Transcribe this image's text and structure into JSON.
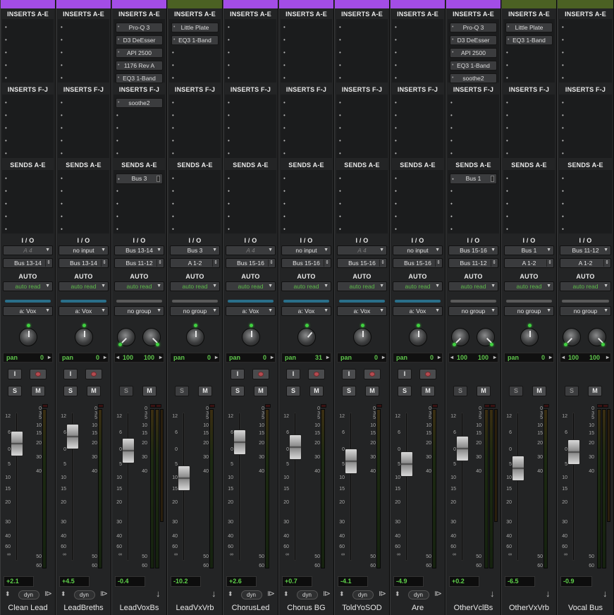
{
  "colors": {
    "purple": "#a34de6",
    "olive": "#4b6123",
    "autoread": "#5dbb4a",
    "green": "#5fd24a"
  },
  "labels": {
    "inserts_ae": "INSERTS A-E",
    "inserts_fj": "INSERTS F-J",
    "sends_ae": "SENDS A-E",
    "io": "I / O",
    "auto": "AUTO",
    "dyn": "dyn",
    "pan": "pan",
    "input_btn": "I",
    "solo": "S",
    "mute": "M"
  },
  "fader_scale": [
    "12",
    "6",
    "0",
    "5",
    "10",
    "15",
    "20",
    "30",
    "40",
    "60",
    "∞"
  ],
  "meter_scale": [
    "0",
    "3",
    "5",
    "10",
    "15",
    "20",
    "30",
    "40",
    "50",
    "60"
  ],
  "channels": [
    {
      "name": "Clean Lead",
      "color": "purple",
      "inserts_ae": [],
      "inserts_fj": [],
      "sends": [],
      "input": "A 4",
      "input_dim": true,
      "output": "Bus 13-14",
      "auto": "auto read",
      "group": "a: Vox",
      "group_color": "#2a6f8a",
      "stereo": false,
      "pan": [
        "0"
      ],
      "knobs": [
        0
      ],
      "has_input_btn": true,
      "has_rec": true,
      "fader_db": 2.1,
      "volume": "+2.1",
      "arrow": "dyn"
    },
    {
      "name": "LeadBreths",
      "color": "purple",
      "inserts_ae": [],
      "inserts_fj": [],
      "sends": [],
      "input": "no input",
      "input_dim": false,
      "output": "Bus 13-14",
      "auto": "auto read",
      "group": "a: Vox",
      "group_color": "#2a6f8a",
      "stereo": false,
      "pan": [
        "0"
      ],
      "knobs": [
        0
      ],
      "has_input_btn": true,
      "has_rec": true,
      "fader_db": 4.5,
      "volume": "+4.5",
      "arrow": "dyn"
    },
    {
      "name": "LeadVoxBs",
      "color": "purple",
      "inserts_ae": [
        "Pro-Q 3",
        "D3 DeEsser",
        "API 2500",
        "1176 Rev A",
        "EQ3 1-Band"
      ],
      "inserts_fj": [
        "soothe2"
      ],
      "sends": [
        "Bus 3"
      ],
      "input": "Bus 13-14",
      "input_dim": false,
      "output": "Bus 11-12",
      "auto": "auto read",
      "group": "no group",
      "group_color": "#5a5a5a",
      "stereo": true,
      "pan": [
        "100",
        "100"
      ],
      "knobs": [
        -135,
        135
      ],
      "has_input_btn": false,
      "has_rec": false,
      "fader_db": -0.4,
      "volume": "-0.4",
      "arrow": "down"
    },
    {
      "name": "LeadVxVrb",
      "color": "olive",
      "inserts_ae": [
        "Little Plate",
        "EQ3 1-Band"
      ],
      "inserts_fj": [],
      "sends": [],
      "input": "Bus 3",
      "input_dim": false,
      "output": "A 1-2",
      "auto": "auto read",
      "group": "no group",
      "group_color": "#5a5a5a",
      "stereo": false,
      "pan": [
        "0"
      ],
      "knobs": [
        0
      ],
      "has_input_btn": false,
      "has_rec": false,
      "fader_db": -10.2,
      "volume": "-10.2",
      "arrow": "down"
    },
    {
      "name": "ChorusLed",
      "color": "purple",
      "inserts_ae": [],
      "inserts_fj": [],
      "sends": [],
      "input": "A 4",
      "input_dim": true,
      "output": "Bus 15-16",
      "auto": "auto read",
      "group": "a: Vox",
      "group_color": "#2a6f8a",
      "stereo": false,
      "pan": [
        "0"
      ],
      "knobs": [
        0
      ],
      "has_input_btn": true,
      "has_rec": true,
      "fader_db": 2.6,
      "volume": "+2.6",
      "arrow": "dyn"
    },
    {
      "name": "Chorus BG",
      "color": "purple",
      "inserts_ae": [],
      "inserts_fj": [],
      "sends": [],
      "input": "no input",
      "input_dim": false,
      "output": "Bus 15-16",
      "auto": "auto read",
      "group": "a: Vox",
      "group_color": "#2a6f8a",
      "stereo": false,
      "pan": [
        "31"
      ],
      "knobs": [
        40
      ],
      "has_input_btn": true,
      "has_rec": true,
      "fader_db": 0.7,
      "volume": "+0.7",
      "arrow": "dyn"
    },
    {
      "name": "ToldYoSOD",
      "color": "purple",
      "inserts_ae": [],
      "inserts_fj": [],
      "sends": [],
      "input": "A 4",
      "input_dim": true,
      "output": "Bus 15-16",
      "auto": "auto read",
      "group": "a: Vox",
      "group_color": "#2a6f8a",
      "stereo": false,
      "pan": [
        "0"
      ],
      "knobs": [
        0
      ],
      "has_input_btn": true,
      "has_rec": true,
      "fader_db": -4.1,
      "volume": "-4.1",
      "arrow": "dyn"
    },
    {
      "name": "Are",
      "color": "purple",
      "inserts_ae": [],
      "inserts_fj": [],
      "sends": [],
      "input": "no input",
      "input_dim": false,
      "output": "Bus 15-16",
      "auto": "auto read",
      "group": "a: Vox",
      "group_color": "#2a6f8a",
      "stereo": false,
      "pan": [
        "0"
      ],
      "knobs": [
        0
      ],
      "has_input_btn": true,
      "has_rec": true,
      "fader_db": -4.9,
      "volume": "-4.9",
      "arrow": "dyn"
    },
    {
      "name": "OtherVclBs",
      "color": "purple",
      "inserts_ae": [
        "Pro-Q 3",
        "D3 DeEsser",
        "API 2500",
        "EQ3 1-Band",
        "soothe2"
      ],
      "inserts_fj": [],
      "sends": [
        "Bus 1"
      ],
      "input": "Bus 15-16",
      "input_dim": false,
      "output": "Bus 11-12",
      "auto": "auto read",
      "group": "no group",
      "group_color": "#5a5a5a",
      "stereo": true,
      "pan": [
        "100",
        "100"
      ],
      "knobs": [
        -135,
        135
      ],
      "has_input_btn": false,
      "has_rec": false,
      "fader_db": 0.2,
      "volume": "+0.2",
      "arrow": "down"
    },
    {
      "name": "OtherVxVrb",
      "color": "olive",
      "inserts_ae": [
        "Little Plate",
        "EQ3 1-Band"
      ],
      "inserts_fj": [],
      "sends": [],
      "input": "Bus 1",
      "input_dim": false,
      "output": "A 1-2",
      "auto": "auto read",
      "group": "no group",
      "group_color": "#5a5a5a",
      "stereo": false,
      "pan": [
        "0"
      ],
      "knobs": [
        0
      ],
      "has_input_btn": false,
      "has_rec": false,
      "fader_db": -6.5,
      "volume": "-6.5",
      "arrow": "down"
    },
    {
      "name": "Vocal Bus",
      "color": "olive",
      "inserts_ae": [],
      "inserts_fj": [],
      "sends": [],
      "input": "Bus 11-12",
      "input_dim": false,
      "output": "A 1-2",
      "auto": "auto read",
      "group": "no group",
      "group_color": "#5a5a5a",
      "stereo": true,
      "pan": [
        "100",
        "100"
      ],
      "knobs": [
        -135,
        135
      ],
      "has_input_btn": false,
      "has_rec": false,
      "fader_db": -0.9,
      "volume": "-0.9",
      "arrow": "down"
    }
  ]
}
